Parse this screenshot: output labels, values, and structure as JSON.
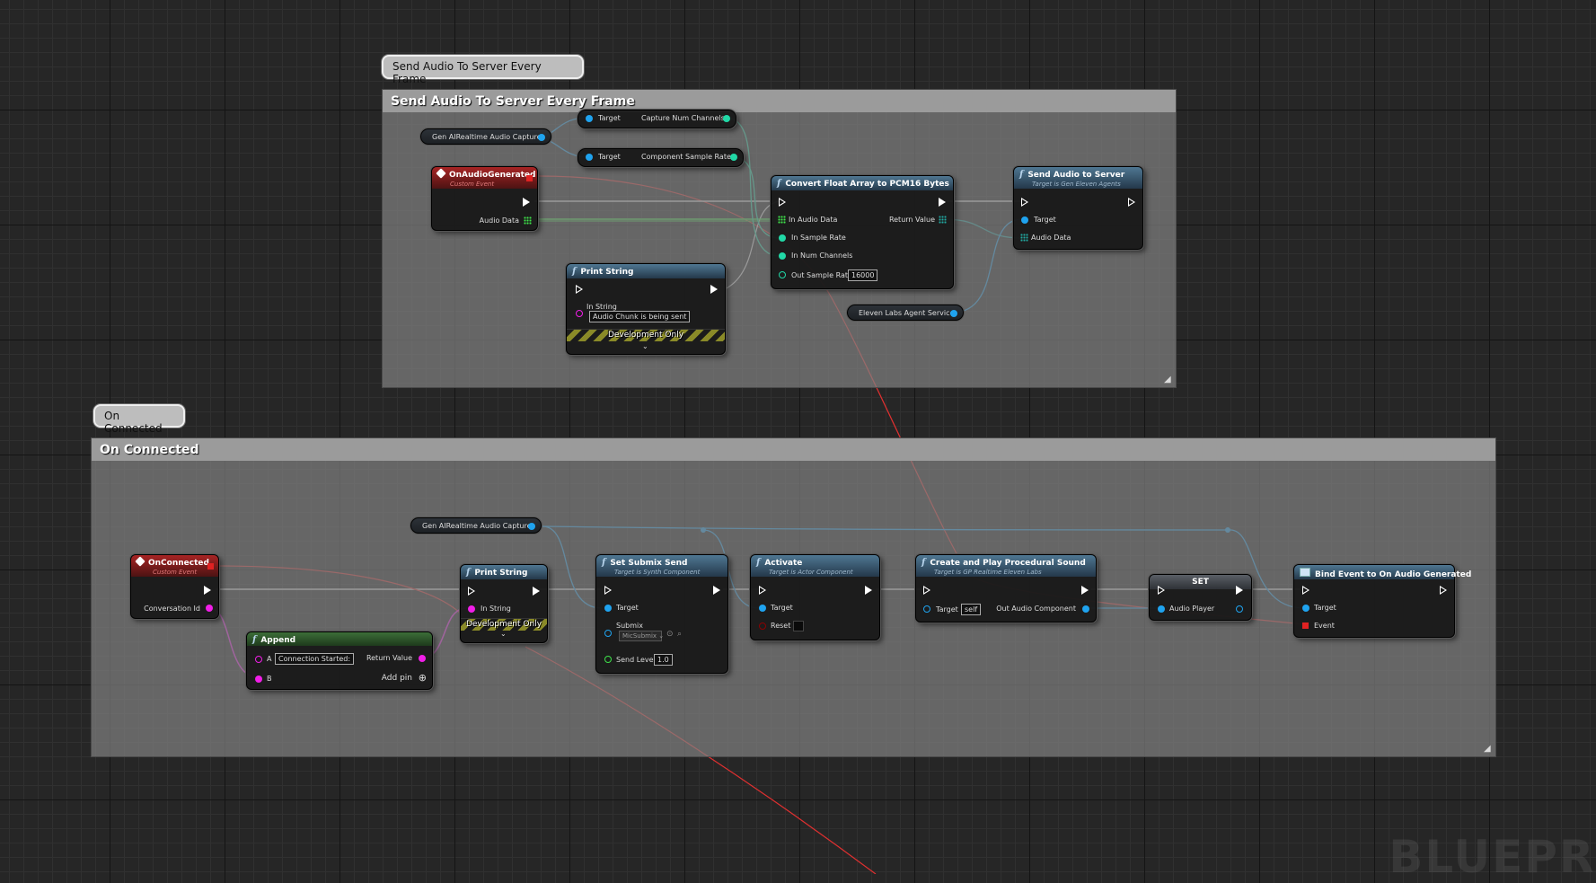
{
  "comments": {
    "top_bubble": "Send Audio To Server Every Frame",
    "top_title": "Send Audio To Server Every Frame",
    "bottom_bubble": "On Connected",
    "bottom_title": "On Connected"
  },
  "top": {
    "var_capture": "Gen AIRealtime Audio Capture",
    "num_channels": {
      "target": "Target",
      "out": "Capture Num Channels"
    },
    "sample_rate": {
      "target": "Target",
      "out": "Component Sample Rate"
    },
    "on_audio": {
      "title": "OnAudioGenerated",
      "subtitle": "Custom Event",
      "audio_data": "Audio Data"
    },
    "print": {
      "title": "Print String",
      "in_string": "In String",
      "value": "Audio Chunk is being sent",
      "dev": "Development Only"
    },
    "convert": {
      "title": "Convert Float Array to PCM16 Bytes",
      "in_audio": "In Audio Data",
      "in_rate": "In Sample Rate",
      "in_ch": "In Num Channels",
      "out_rate": "Out Sample Rate",
      "out_rate_val": "16000",
      "ret": "Return Value"
    },
    "send": {
      "title": "Send Audio to Server",
      "subtitle": "Target is Gen Eleven Agents",
      "target": "Target",
      "audio": "Audio Data"
    },
    "var_service": "Eleven Labs Agent Service"
  },
  "bottom": {
    "var_capture": "Gen AIRealtime Audio Capture",
    "on_connected": {
      "title": "OnConnected",
      "subtitle": "Custom Event",
      "conv": "Conversation Id"
    },
    "append": {
      "title": "Append",
      "a": "A",
      "a_val": "Connection Started:",
      "b": "B",
      "ret": "Return Value",
      "add": "Add pin"
    },
    "print": {
      "title": "Print String",
      "in_string": "In String",
      "dev": "Development Only"
    },
    "submix": {
      "title": "Set Submix Send",
      "subtitle": "Target is Synth Component",
      "target": "Target",
      "submix": "Submix",
      "submix_val": "MicSubmix",
      "level": "Send Level",
      "level_val": "1.0"
    },
    "activate": {
      "title": "Activate",
      "subtitle": "Target is Actor Component",
      "target": "Target",
      "reset": "Reset"
    },
    "create": {
      "title": "Create and Play Procedural Sound",
      "subtitle": "Target is GP Realtime Eleven Labs",
      "target": "Target",
      "target_val": "self",
      "out": "Out Audio Component"
    },
    "set": {
      "title": "SET",
      "player": "Audio Player"
    },
    "bind": {
      "title": "Bind Event to On Audio Generated",
      "target": "Target",
      "event": "Event"
    }
  },
  "watermark": "BLUEPRI",
  "colors": {
    "exec": "#ffffff",
    "object": "#1fa3ef",
    "int": "#21d8a6",
    "float": "#3ee34a",
    "string": "#f11ee8",
    "delegate": "#e02222",
    "bool": "#8c0000"
  }
}
